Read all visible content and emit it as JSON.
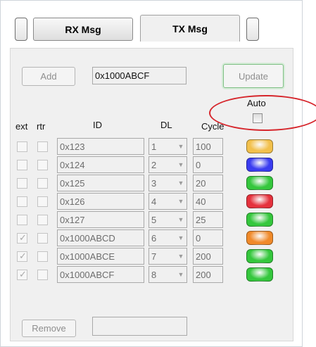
{
  "tabs": {
    "rx_label": "RX Msg",
    "tx_label": "TX Msg"
  },
  "toolbar": {
    "add_label": "Add",
    "id_value": "0x1000ABCF",
    "update_label": "Update"
  },
  "headers": {
    "ext": "ext",
    "rtr": "rtr",
    "id": "ID",
    "dl": "DL",
    "cycle": "Cycle",
    "auto": "Auto"
  },
  "auto_checked": false,
  "rows": [
    {
      "ext": false,
      "rtr": false,
      "id": "0x123",
      "dl": "1",
      "cycle": "100",
      "color": "#f2c04c"
    },
    {
      "ext": false,
      "rtr": false,
      "id": "0x124",
      "dl": "2",
      "cycle": "0",
      "color": "#3a3cf0"
    },
    {
      "ext": false,
      "rtr": false,
      "id": "0x125",
      "dl": "3",
      "cycle": "20",
      "color": "#35c73d"
    },
    {
      "ext": false,
      "rtr": false,
      "id": "0x126",
      "dl": "4",
      "cycle": "40",
      "color": "#e5323d"
    },
    {
      "ext": false,
      "rtr": false,
      "id": "0x127",
      "dl": "5",
      "cycle": "25",
      "color": "#35c73d"
    },
    {
      "ext": true,
      "rtr": false,
      "id": "0x1000ABCD",
      "dl": "6",
      "cycle": "0",
      "color": "#f08a2a"
    },
    {
      "ext": true,
      "rtr": false,
      "id": "0x1000ABCE",
      "dl": "7",
      "cycle": "200",
      "color": "#35c73d"
    },
    {
      "ext": true,
      "rtr": false,
      "id": "0x1000ABCF",
      "dl": "8",
      "cycle": "200",
      "color": "#35c73d"
    }
  ],
  "footer": {
    "remove_label": "Remove",
    "status_value": ""
  }
}
